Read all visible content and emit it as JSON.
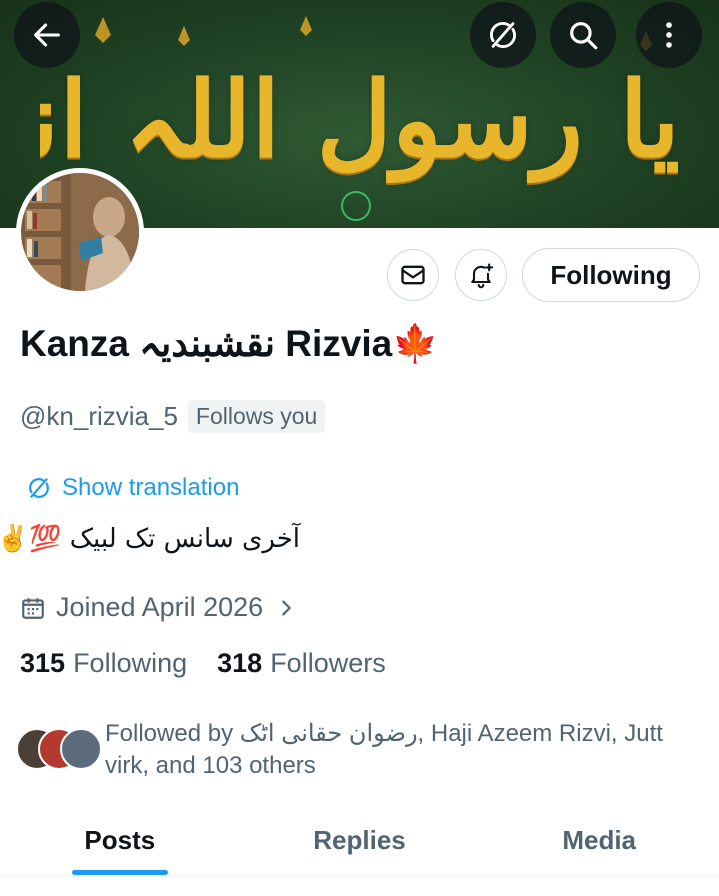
{
  "banner": {
    "calligraphy": "یا رسول اللہ انظر حالنا"
  },
  "top_bar": {
    "back_icon": "arrow-left-icon",
    "translate_icon": "translate-icon",
    "search_icon": "search-icon",
    "more_icon": "more-vertical-icon"
  },
  "actions": {
    "message_icon": "envelope-icon",
    "notify_icon": "bell-plus-icon",
    "following_label": "Following"
  },
  "profile": {
    "display_name": "Kanza نقشبندیہ Rizvia🍁",
    "handle": "@kn_rizvia_5",
    "follows_you": "Follows you",
    "show_translation": "Show translation",
    "bio": "آخری سانس تک لبیک 💯✌️",
    "joined": "Joined April 2026",
    "following_count": "315",
    "following_label": "Following",
    "followers_count": "318",
    "followers_label": "Followers",
    "followed_by": "Followed by رضوان حقانی اٹک, Haji Azeem Rizvi, Jutt virk, and 103 others"
  },
  "tabs": [
    {
      "label": "Posts",
      "active": true
    },
    {
      "label": "Replies",
      "active": false
    },
    {
      "label": "Media",
      "active": false
    }
  ],
  "colors": {
    "accent": "#1d9bf0",
    "text": "#0f1419",
    "secondary": "#536471",
    "banner_green": "#1f4224",
    "calligraphy_gold": "#e8b62a"
  }
}
